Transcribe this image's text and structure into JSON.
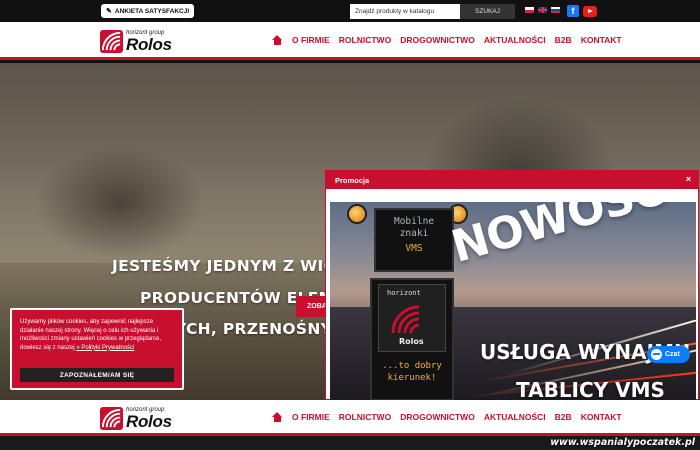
{
  "topbar": {
    "survey_label": "ANKIETA SATYSFAKCJI",
    "search_placeholder": "Znajdź produkty w katalogu",
    "search_button": "SZUKAJ",
    "facebook_glyph": "f"
  },
  "logo": {
    "subtitle": "horizont group",
    "name": "Rolos"
  },
  "nav": {
    "items": [
      "O FIRMIE",
      "ROLNICTWO",
      "DROGOWNICTWO",
      "AKTUALNOŚCI",
      "B2B",
      "KONTAKT"
    ]
  },
  "hero": {
    "line1": "JESTEŚMY JEDNYM Z WIODĄ",
    "line2": "PRODUCENTÓW ELEMENT",
    "line3": "ORAZ DROGOWYCH, PRZENOŚNYCH URZ",
    "button": "ZOBA"
  },
  "cookie": {
    "text": "Używamy plików cookies, aby zapewnić najlepsze działanie naszej strony. Więcej o celu ich używania i możliwości zmiany ustawień cookies w przeglądarce, dowiesz się z naszej ",
    "link": "» Polityki Prywatności",
    "button": "ZAPOZNAŁEM/AM SIĘ"
  },
  "promo": {
    "title": "Promocja",
    "close": "×",
    "sign_top": [
      "Mobilne",
      "znaki",
      "VMS"
    ],
    "sign_logo_sub": "horizont",
    "sign_logo_name": "Rolos",
    "sign_bottom": [
      "...to dobry",
      "kierunek!"
    ],
    "headline": "NOWOŚĆ",
    "sub1": "USŁUGA WYNAJMU",
    "sub2": "TABLICY VMS"
  },
  "chat": {
    "label": "Czat"
  },
  "watermark": "www.wspanialypoczatek.pl",
  "colors": {
    "brand_red": "#c8102e",
    "chat_blue": "#0a7cff"
  }
}
